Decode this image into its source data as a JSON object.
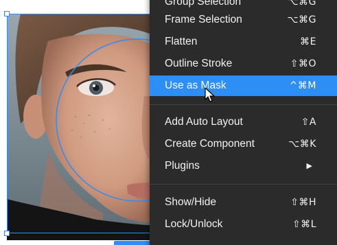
{
  "canvas": {
    "accent_color": "#2f8df5"
  },
  "context_menu": {
    "background": "#2b2b2b",
    "highlight_color": "#2d8ef5",
    "items": [
      {
        "label": "Group Selection",
        "shortcut": "⌥⌘G"
      },
      {
        "label": "Frame Selection",
        "shortcut": "⌥⌘G"
      },
      {
        "label": "Flatten",
        "shortcut": "⌘E"
      },
      {
        "label": "Outline Stroke",
        "shortcut": "⇧⌘O"
      },
      {
        "label": "Use as Mask",
        "shortcut": "^⌘M",
        "active": true
      },
      {
        "label": "Add Auto Layout",
        "shortcut": "⇧A"
      },
      {
        "label": "Create Component",
        "shortcut": "⌥⌘K"
      },
      {
        "label": "Plugins",
        "submenu_icon": "triangle-right-icon"
      },
      {
        "label": "Show/Hide",
        "shortcut": "⇧⌘H"
      },
      {
        "label": "Lock/Unlock",
        "shortcut": "⇧⌘L"
      }
    ]
  },
  "cursor": {
    "icon": "pointer-arrow-icon"
  }
}
